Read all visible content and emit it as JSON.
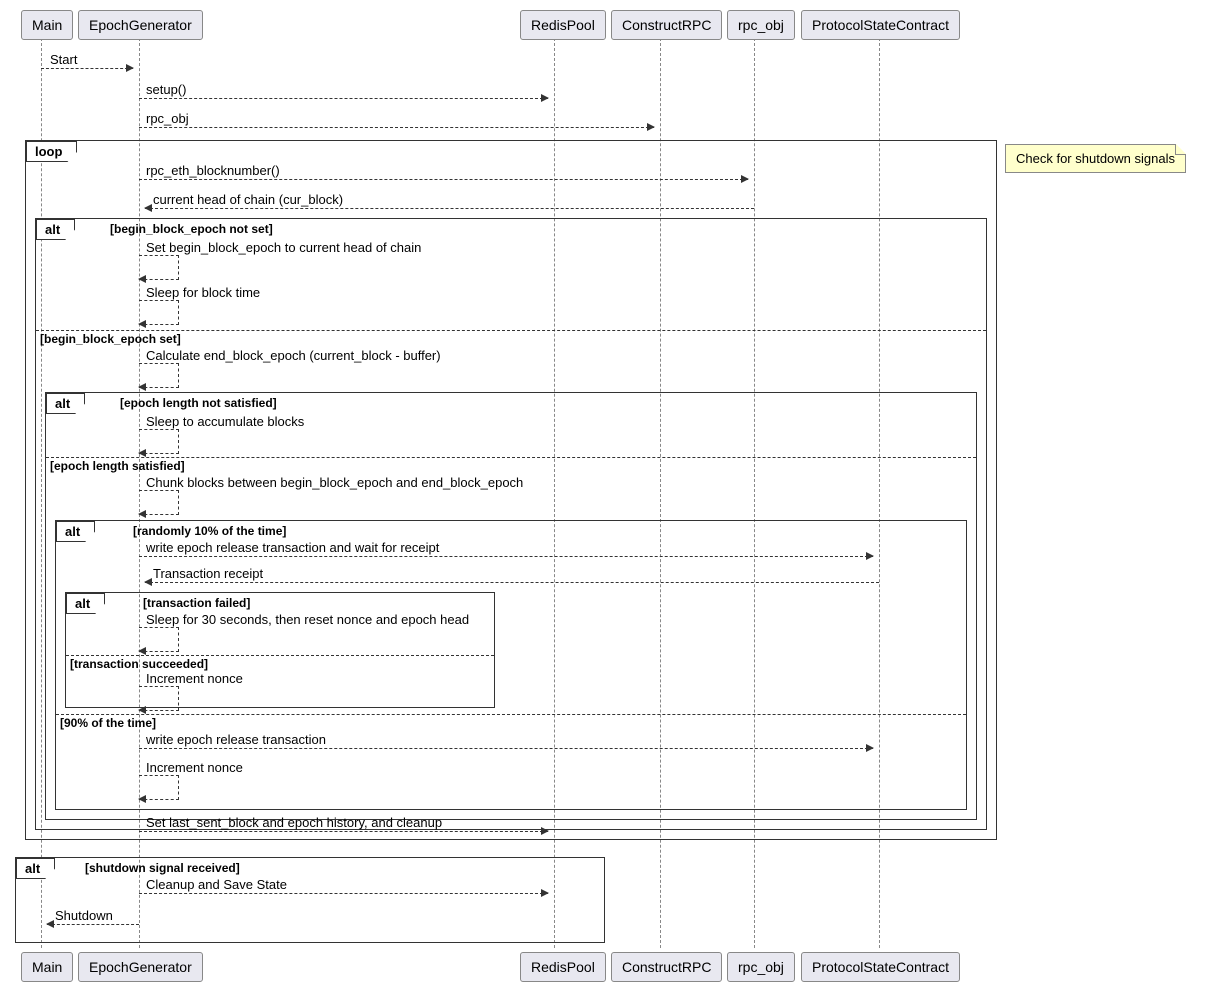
{
  "participants": {
    "main": "Main",
    "epoch_generator": "EpochGenerator",
    "redis_pool": "RedisPool",
    "construct_rpc": "ConstructRPC",
    "rpc_obj": "rpc_obj",
    "protocol_state_contract": "ProtocolStateContract"
  },
  "messages": {
    "start": "Start",
    "setup": "setup()",
    "rpc_obj_msg": "rpc_obj",
    "rpc_eth_blocknumber": "rpc_eth_blocknumber()",
    "current_head": "current head of chain (cur_block)",
    "set_begin_block": "Set begin_block_epoch to current head of chain",
    "sleep_block_time": "Sleep for block time",
    "calc_end_block": "Calculate end_block_epoch (current_block - buffer)",
    "sleep_accumulate": "Sleep to accumulate blocks",
    "chunk_blocks": "Chunk blocks between begin_block_epoch and end_block_epoch",
    "write_epoch_wait": "write epoch release transaction and wait for receipt",
    "tx_receipt": "Transaction receipt",
    "sleep_30": "Sleep for 30 seconds, then reset nonce and epoch head",
    "inc_nonce": "Increment nonce",
    "write_epoch": "write epoch release transaction",
    "inc_nonce2": "Increment nonce",
    "set_last_sent": "Set last_sent_block and epoch history, and cleanup",
    "cleanup_save": "Cleanup and Save State",
    "shutdown": "Shutdown"
  },
  "fragments": {
    "loop": "loop",
    "alt": "alt"
  },
  "guards": {
    "begin_not_set": "[begin_block_epoch not set]",
    "begin_set": "[begin_block_epoch set]",
    "epoch_not_satisfied": "[epoch length not satisfied]",
    "epoch_satisfied": "[epoch length satisfied]",
    "random_10": "[randomly 10% of the time]",
    "tx_failed": "[transaction failed]",
    "tx_succeeded": "[transaction succeeded]",
    "ninety_pct": "[90% of the time]",
    "shutdown_received": "[shutdown signal received]"
  },
  "note": "Check for shutdown signals"
}
